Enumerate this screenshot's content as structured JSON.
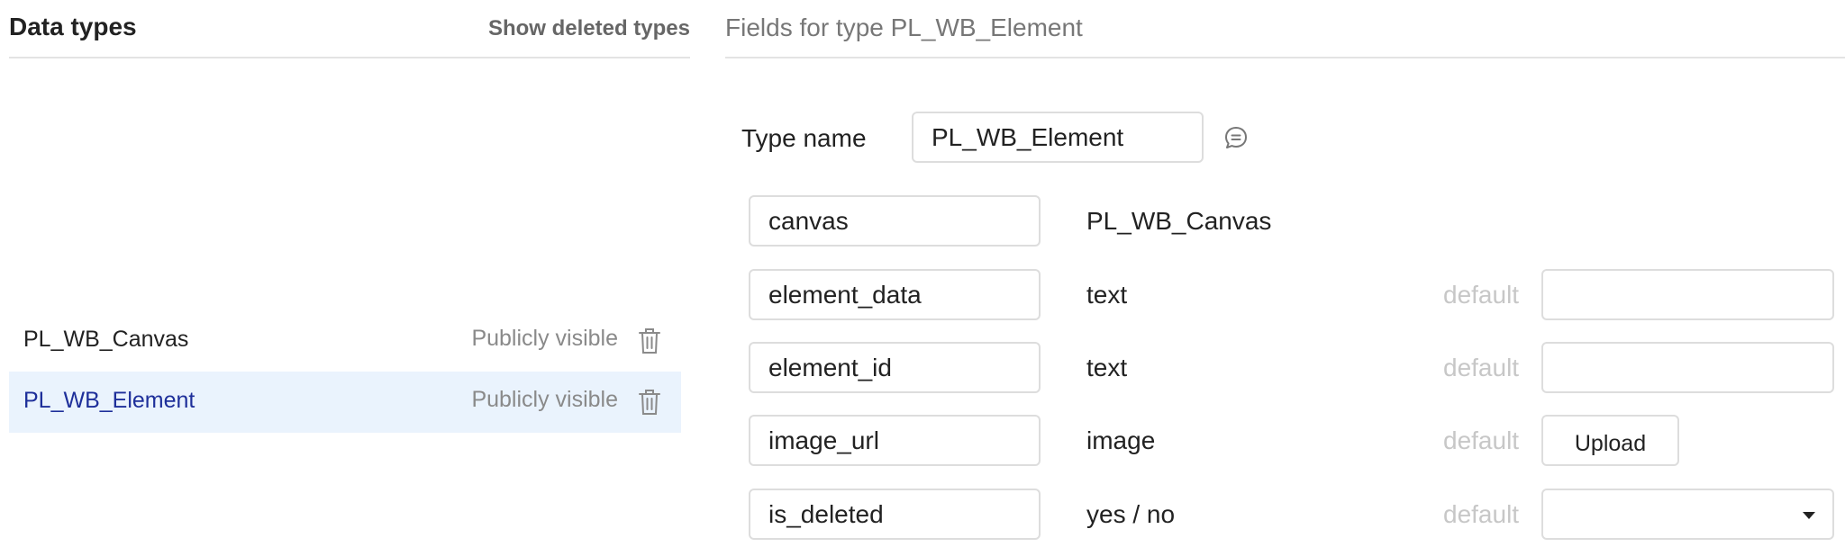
{
  "left": {
    "title": "Data types",
    "show_deleted": "Show deleted types",
    "types": [
      {
        "name": "PL_WB_Canvas",
        "visibility": "Publicly visible",
        "selected": false
      },
      {
        "name": "PL_WB_Element",
        "visibility": "Publicly visible",
        "selected": true
      }
    ]
  },
  "right": {
    "title": "Fields for type PL_WB_Element",
    "type_name_label": "Type name",
    "type_name_value": "PL_WB_Element",
    "default_label": "default",
    "upload_label": "Upload",
    "fields": [
      {
        "name": "canvas",
        "type": "PL_WB_Canvas"
      },
      {
        "name": "element_data",
        "type": "text"
      },
      {
        "name": "element_id",
        "type": "text"
      },
      {
        "name": "image_url",
        "type": "image"
      },
      {
        "name": "is_deleted",
        "type": "yes / no"
      }
    ]
  },
  "icons": {
    "trash": "trash-icon",
    "comment": "comment-icon",
    "caret": "caret-down-icon"
  },
  "colors": {
    "selected_row_bg": "#eaf3fd",
    "selected_text": "#1e2f9a",
    "muted_text": "#8a8a8a",
    "border": "#dddddd"
  }
}
